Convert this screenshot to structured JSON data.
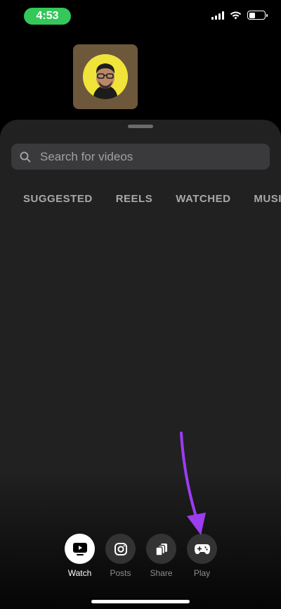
{
  "status_bar": {
    "time": "4:53",
    "icons": [
      "signal-icon",
      "wifi-icon",
      "battery-icon"
    ]
  },
  "thumbnail": {
    "icon": "avatar-portrait"
  },
  "search": {
    "placeholder": "Search for videos",
    "icon": "search-icon"
  },
  "tabs": [
    {
      "label": "SUGGESTED"
    },
    {
      "label": "REELS"
    },
    {
      "label": "WATCHED"
    },
    {
      "label": "MUSIC"
    }
  ],
  "nav": [
    {
      "label": "Watch",
      "icon": "tv-play-icon",
      "active": true
    },
    {
      "label": "Posts",
      "icon": "instagram-icon",
      "active": false
    },
    {
      "label": "Share",
      "icon": "share-cards-icon",
      "active": false
    },
    {
      "label": "Play",
      "icon": "gamepad-icon",
      "active": false
    }
  ],
  "colors": {
    "time_pill": "#34c759",
    "sheet": "#212121",
    "annotation_arrow": "#9b3df0"
  }
}
